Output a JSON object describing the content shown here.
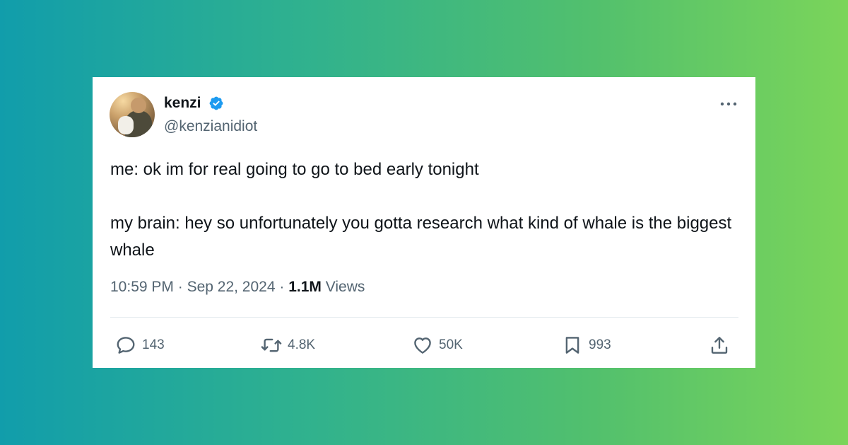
{
  "tweet": {
    "author": {
      "name": "kenzi",
      "handle": "@kenzianidiot",
      "verified": true
    },
    "text": "me: ok im for real going to go to bed early tonight\n\nmy brain: hey so unfortunately you gotta research what kind of whale is the biggest whale",
    "time": "10:59 PM",
    "separator": "·",
    "date": "Sep 22, 2024",
    "views_count": "1.1M",
    "views_label": "Views",
    "stats": {
      "replies": "143",
      "reposts": "4.8K",
      "likes": "50K",
      "bookmarks": "993"
    },
    "colors": {
      "verified_badge": "#1d9bf0",
      "icon": "#536471",
      "text": "#0f1419"
    },
    "icons": [
      "verified-badge-icon",
      "more-icon",
      "reply-icon",
      "repost-icon",
      "like-icon",
      "bookmark-icon",
      "share-icon"
    ]
  }
}
